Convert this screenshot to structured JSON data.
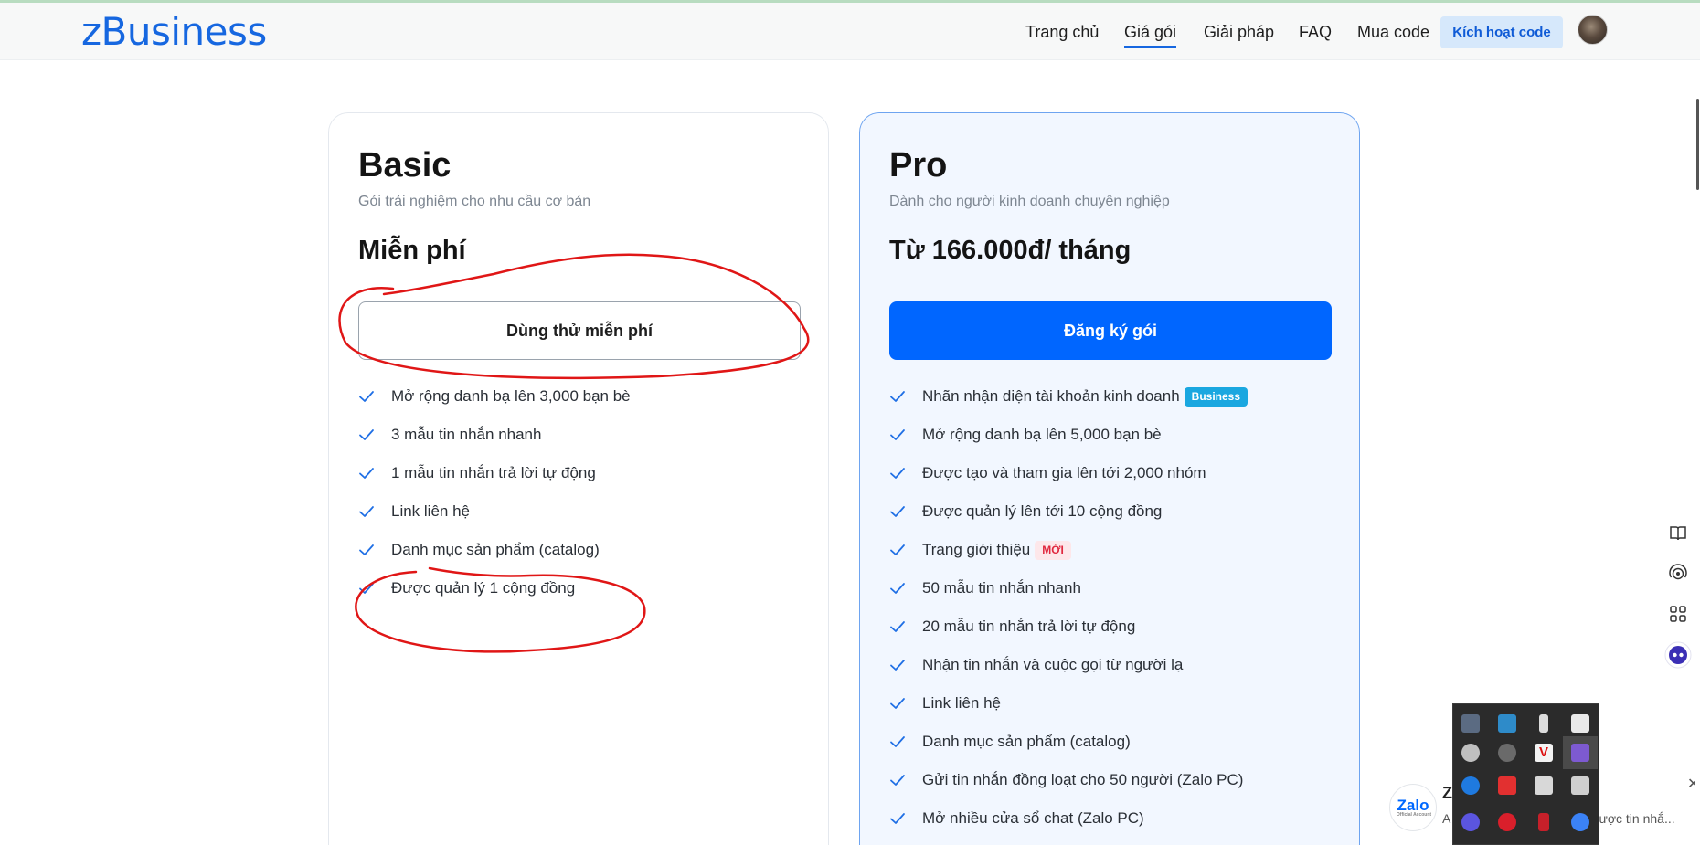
{
  "header": {
    "logo": "zBusiness",
    "nav": [
      {
        "label": "Trang chủ",
        "active": false
      },
      {
        "label": "Giá gói",
        "active": true
      },
      {
        "label": "Giải pháp",
        "active": false
      },
      {
        "label": "FAQ",
        "active": false
      },
      {
        "label": "Mua code",
        "active": false
      }
    ],
    "activate_label": "Kích hoạt code",
    "accent_color": "#1667e0"
  },
  "plans": {
    "basic": {
      "title": "Basic",
      "subtitle": "Gói trải nghiệm cho nhu cầu cơ bản",
      "price": "Miễn phí",
      "button": "Dùng thử miễn phí",
      "features": [
        "Mở rộng danh bạ lên 3,000 bạn bè",
        "3 mẫu tin nhắn nhanh",
        "1 mẫu tin nhắn trả lời tự động",
        "Link liên hệ",
        "Danh mục sản phẩm (catalog)",
        "Được quản lý 1 cộng đồng"
      ]
    },
    "pro": {
      "title": "Pro",
      "subtitle": "Dành cho người kinh doanh chuyên nghiệp",
      "price": "Từ 166.000đ/ tháng",
      "button": "Đăng ký gói",
      "features": [
        "Nhãn nhận diện tài khoản kinh doanh",
        "Mở rộng danh bạ lên 5,000 bạn bè",
        "Được tạo và tham gia lên tới 2,000 nhóm",
        "Được quản lý lên tới 10 cộng đồng",
        "Trang giới thiệu",
        "50 mẫu tin nhắn nhanh",
        "20 mẫu tin nhắn trả lời tự động",
        "Nhận tin nhắn và cuộc gọi từ người lạ",
        "Link liên hệ",
        "Danh mục sản phẩm (catalog)",
        "Gửi tin nhắn đồng loạt cho 50 người (Zalo PC)",
        "Mở nhiều cửa sổ chat (Zalo PC)"
      ],
      "badge_business": "Business",
      "badge_new": "MỚI",
      "primary_color": "#0066ff"
    }
  },
  "side_tools": [
    "book-icon",
    "broadcast-icon",
    "grid-icon",
    "bot-icon"
  ],
  "notification": {
    "logo_text": "Zalo",
    "logo_sub": "Official Account",
    "title": "Z",
    "message_start": "A",
    "message_end": "n được tin nhắ..."
  },
  "tray_icons": [
    "monitor-icon",
    "network-icon",
    "usb-icon",
    "shield-icon",
    "pen-icon",
    "cloud-off-icon",
    "v-icon",
    "feather-icon",
    "app-blue-icon",
    "record-icon",
    "webcam-icon",
    "box-icon",
    "gear-purple-icon",
    "chat-red-icon",
    "mic-red-icon",
    "messenger-icon"
  ]
}
